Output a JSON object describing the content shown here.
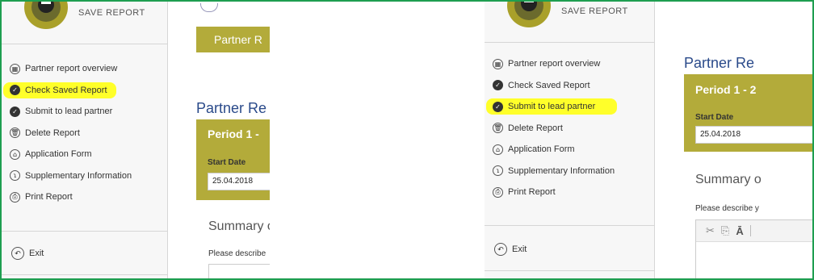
{
  "save_report_label": "SAVE REPORT",
  "menu": [
    {
      "label": "Partner report overview",
      "icon": "grid-icon"
    },
    {
      "label": "Check Saved Report",
      "icon": "check-icon"
    },
    {
      "label": "Submit to lead partner",
      "icon": "check-icon"
    },
    {
      "label": "Delete Report",
      "icon": "trash-icon"
    },
    {
      "label": "Application Form",
      "icon": "bank-icon"
    },
    {
      "label": "Supplementary Information",
      "icon": "info-icon"
    },
    {
      "label": "Print Report",
      "icon": "print-icon"
    }
  ],
  "exit_label": "Exit",
  "left_panel": {
    "highlighted_item": "Check Saved Report",
    "tab_label": "Partner R",
    "title": "Partner Re",
    "period": "Period 1 -",
    "start_date_label": "Start Date",
    "start_date_value": "25.04.2018",
    "summary_heading": "Summary o",
    "describe_text": "Please describe"
  },
  "right_panel": {
    "highlighted_item": "Submit to lead partner",
    "title": "Partner Re",
    "period": "Period 1 - 2",
    "start_date_label": "Start Date",
    "start_date_value": "25.04.2018",
    "summary_heading": "Summary o",
    "describe_text": "Please describe y",
    "toolbar_icons": [
      "cut-icon",
      "copy-icon",
      "paste-text-icon"
    ]
  },
  "colors": {
    "frame_border": "#1e9e50",
    "accent_olive": "#b3ab3a",
    "highlight": "#ffff2a",
    "title_blue": "#2a4a8a"
  }
}
